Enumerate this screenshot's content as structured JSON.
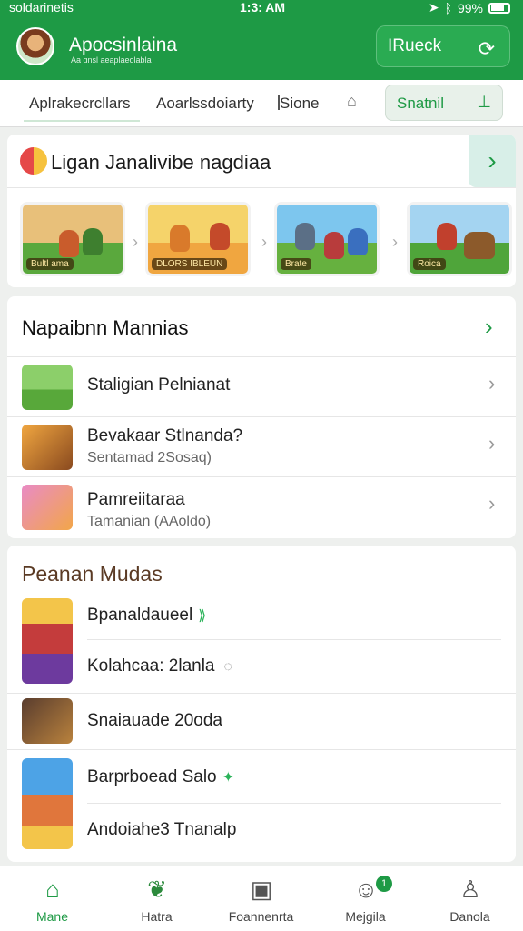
{
  "status_bar": {
    "carrier": "soldarinetis",
    "time": "1:3: AM",
    "battery": "99%"
  },
  "header": {
    "title": "Apocsinlaina",
    "subtitle": "Aa ɑnsl aeaplaeolabla",
    "action_label": "IRueck"
  },
  "tabs": {
    "items": [
      "Aplrakecrcllars",
      "Aoarlssdoiarty",
      "Sione"
    ],
    "pill_label": "Snatnil"
  },
  "featured": {
    "title": "Ligan Janalivibe nagdiaa",
    "thumbnails": [
      {
        "caption": "Bultl ama",
        "sky": "#e8c07a",
        "ground": "#5aa83d"
      },
      {
        "caption": "DLORS IBLEUN",
        "sky": "#f5d36a",
        "ground": "#f0a640"
      },
      {
        "caption": "Brate",
        "sky": "#7dc6ee",
        "ground": "#66b13f"
      },
      {
        "caption": "Roica",
        "sky": "#a4d4f1",
        "ground": "#4fa53a"
      }
    ]
  },
  "list_section": {
    "heading": "Napaibnn Mannias",
    "items": [
      {
        "title": "Staligian Pelnianat",
        "subtitle": ""
      },
      {
        "title": "Bevakaar Stlnanda?",
        "subtitle": "Sentamad 2Sosaq)"
      },
      {
        "title": "Pamreiitaraa",
        "subtitle": "Tamanian (AAoldo)"
      }
    ]
  },
  "recent_section": {
    "heading": "Peanan Mudas",
    "items": [
      {
        "title": "Bpanaldaueel",
        "tag": "⟫"
      },
      {
        "title": "Kolahcaa: 2lanla",
        "tag": ""
      },
      {
        "title": "Snaiauade 20oda",
        "tag": ""
      },
      {
        "title": "Barprboead Salo",
        "tag": "✦"
      },
      {
        "title": "Andoiahe3 Tnanalp",
        "tag": ""
      }
    ]
  },
  "bottom_nav": {
    "items": [
      {
        "label": "Mane",
        "icon": "home-icon"
      },
      {
        "label": "Hatra",
        "icon": "leaf-icon"
      },
      {
        "label": "Foannenrta",
        "icon": "spiral-icon"
      },
      {
        "label": "Mejgila",
        "icon": "people-icon"
      },
      {
        "label": "Danola",
        "icon": "profile-icon"
      }
    ],
    "badge_count": "1"
  },
  "colors": {
    "brand": "#1e9a45",
    "header_bg": "#1e9a45",
    "recent_heading": "#5a3a24"
  }
}
